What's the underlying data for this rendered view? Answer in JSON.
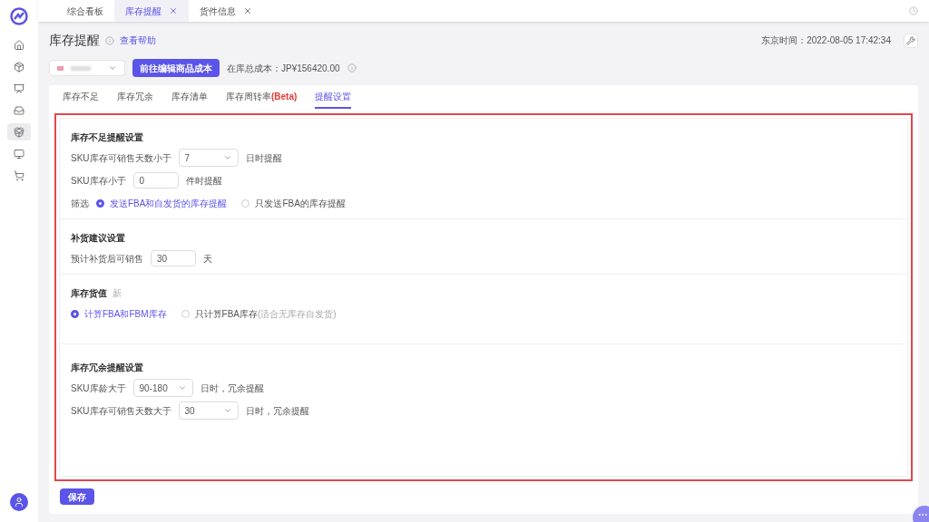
{
  "sidebar": {
    "items": [
      {
        "selected": false
      },
      {
        "selected": false
      },
      {
        "selected": false
      },
      {
        "selected": false
      },
      {
        "selected": true
      },
      {
        "selected": false
      },
      {
        "selected": false
      }
    ]
  },
  "top_tabs": [
    {
      "label": "综合看板",
      "selected": false,
      "closable": false
    },
    {
      "label": "库存提醒",
      "selected": true,
      "closable": true
    },
    {
      "label": "货件信息",
      "selected": false,
      "closable": true
    }
  ],
  "page": {
    "title": "库存提醒",
    "help_link": "查看帮助",
    "time": "东京时间：2022-08-05 17:42:34",
    "cost_button": "前往编辑商品成本",
    "cost_text": "在库总成本：JP¥156420.00"
  },
  "tabs": [
    {
      "label": "库存不足",
      "selected": false
    },
    {
      "label": "库存冗余",
      "selected": false
    },
    {
      "label": "库存清单",
      "selected": false
    },
    {
      "label": "库存周转率",
      "badge": "(Beta)",
      "selected": false
    },
    {
      "label": "提醒设置",
      "selected": true
    }
  ],
  "sections": [
    {
      "title": "库存不足提醒设置",
      "rows": [
        {
          "kind": "select",
          "label": "SKU库存可销售天数小于",
          "value": "7",
          "suffix": "日时提醒"
        },
        {
          "kind": "input",
          "label": "SKU库存小于",
          "value": "0",
          "suffix": "件时提醒"
        },
        {
          "kind": "radio",
          "label": "筛选",
          "options": [
            {
              "label": "发送FBA和自发货的库存提醒",
              "selected": true
            },
            {
              "label": "只发送FBA的库存提醒",
              "selected": false
            }
          ]
        }
      ]
    },
    {
      "title": "补货建议设置",
      "rows": [
        {
          "kind": "input",
          "label": "预计补货后可销售",
          "value": "30",
          "suffix": "天"
        }
      ]
    },
    {
      "title": "库存货值",
      "badge": "新",
      "rows": [
        {
          "kind": "radio",
          "options": [
            {
              "label": "计算FBA和FBM库存",
              "selected": true
            },
            {
              "label": "只计算FBA库存",
              "note": "(适合无库存自发货)",
              "selected": false
            }
          ]
        }
      ]
    },
    {
      "title": "库存冗余提醒设置",
      "rows": [
        {
          "kind": "select",
          "label": "SKU库龄大于",
          "value": "90-180",
          "suffix": "日时，冗余提醒"
        },
        {
          "kind": "select",
          "label": "SKU库存可销售天数大于",
          "value": "30",
          "suffix": "日时，冗余提醒"
        }
      ]
    }
  ],
  "save_button": "保存"
}
